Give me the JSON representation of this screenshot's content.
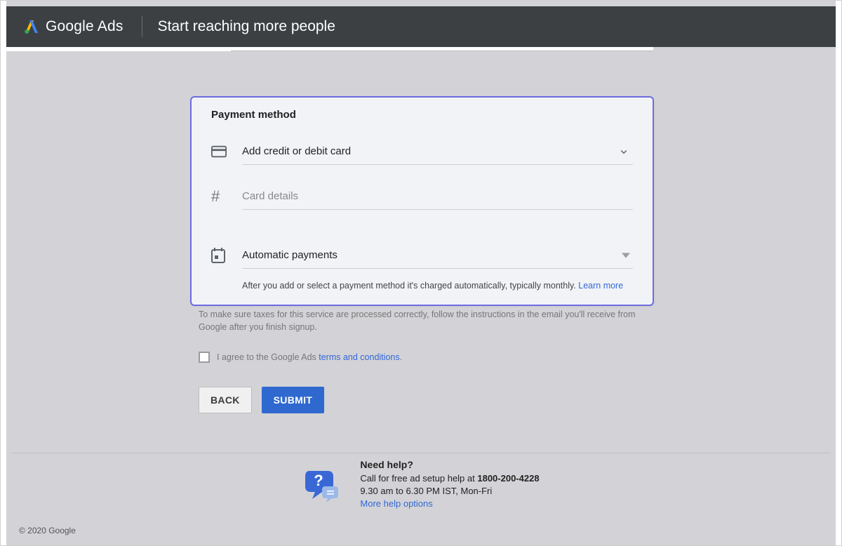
{
  "header": {
    "brand_prefix": "Google",
    "brand_suffix": " Ads",
    "title": "Start reaching more people"
  },
  "payment_card": {
    "title": "Payment method",
    "add_card_label": "Add credit or debit card",
    "card_details_placeholder": "Card details",
    "auto_payments_label": "Automatic payments",
    "auto_payments_help": "After you add or select a payment method it's charged automatically, typically monthly. ",
    "learn_more": "Learn more"
  },
  "tax_note": "To make sure taxes for this service are processed correctly, follow the instructions in the email you'll receive from Google after you finish signup.",
  "agree": {
    "prefix": "I agree to the Google Ads ",
    "link": "terms and conditions",
    "suffix": "."
  },
  "buttons": {
    "back": "BACK",
    "submit": "SUBMIT"
  },
  "help": {
    "title": "Need help?",
    "line1_prefix": "Call for free ad setup help at ",
    "phone": "1800-200-4228",
    "hours": "9.30 am to 6.30 PM IST, Mon-Fri",
    "more_link": "More help options"
  },
  "footer": "© 2020 Google"
}
